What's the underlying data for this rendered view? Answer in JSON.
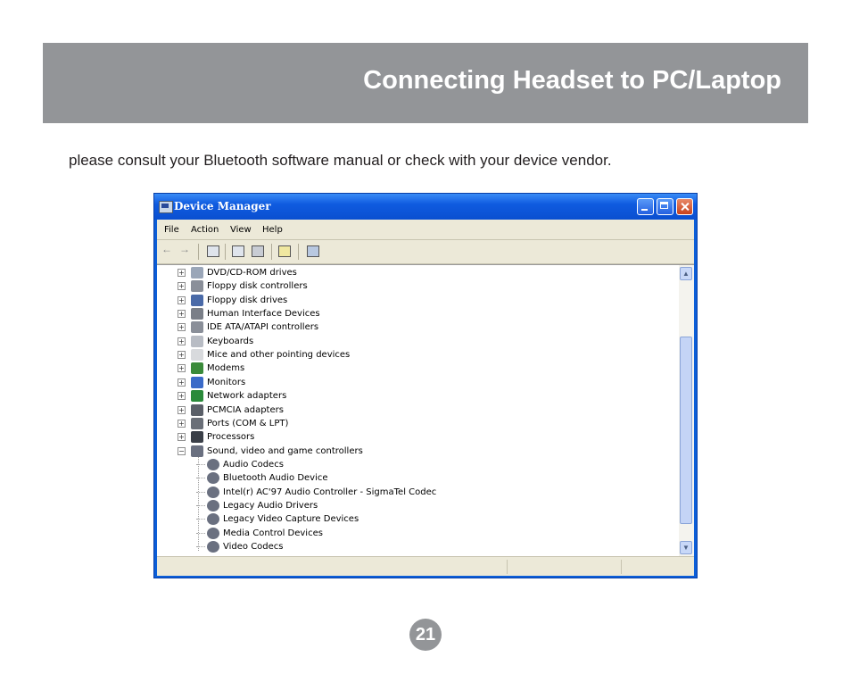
{
  "header": {
    "title": "Connecting Headset to PC/Laptop",
    "band_color": "#939598"
  },
  "intro_text": "please consult your Bluetooth software manual or check with your device vendor.",
  "window": {
    "title": "Device Manager",
    "title_icon": "device-manager-icon",
    "menu": [
      "File",
      "Action",
      "View",
      "Help"
    ],
    "toolbar_icons": [
      "back-arrow-icon",
      "forward-arrow-icon",
      "console-icon",
      "properties-icon",
      "print-icon",
      "help-icon",
      "scan-hardware-icon"
    ],
    "tree": {
      "categories": [
        {
          "label": "DVD/CD-ROM drives",
          "icon": "dvd-drive-icon",
          "color": "#9aa6b8"
        },
        {
          "label": "Floppy disk controllers",
          "icon": "controller-icon",
          "color": "#8a8f99"
        },
        {
          "label": "Floppy disk drives",
          "icon": "floppy-drive-icon",
          "color": "#4a6aa8"
        },
        {
          "label": "Human Interface Devices",
          "icon": "hid-icon",
          "color": "#7a7f88"
        },
        {
          "label": "IDE ATA/ATAPI controllers",
          "icon": "ide-controller-icon",
          "color": "#8a8f99"
        },
        {
          "label": "Keyboards",
          "icon": "keyboard-icon",
          "color": "#b8bcc4"
        },
        {
          "label": "Mice and other pointing devices",
          "icon": "mouse-icon",
          "color": "#d8dadd"
        },
        {
          "label": "Modems",
          "icon": "modem-icon",
          "color": "#3a8a3a"
        },
        {
          "label": "Monitors",
          "icon": "monitor-icon",
          "color": "#3a6ac8"
        },
        {
          "label": "Network adapters",
          "icon": "network-adapter-icon",
          "color": "#2a8a3a"
        },
        {
          "label": "PCMCIA adapters",
          "icon": "pcmcia-icon",
          "color": "#5a5f68"
        },
        {
          "label": "Ports (COM & LPT)",
          "icon": "port-icon",
          "color": "#6a6f78"
        },
        {
          "label": "Processors",
          "icon": "processor-icon",
          "color": "#3a3f48"
        },
        {
          "label": "Sound, video and game controllers",
          "icon": "sound-icon",
          "color": "#6a7080",
          "expanded": true
        }
      ],
      "children": [
        "Audio Codecs",
        "Bluetooth Audio Device",
        "Intel(r) AC'97 Audio Controller - SigmaTel Codec",
        "Legacy Audio Drivers",
        "Legacy Video Capture Devices",
        "Media Control Devices",
        "Video Codecs"
      ],
      "expanded_sign": "−",
      "collapsed_sign": "+"
    }
  },
  "page_number": "21"
}
